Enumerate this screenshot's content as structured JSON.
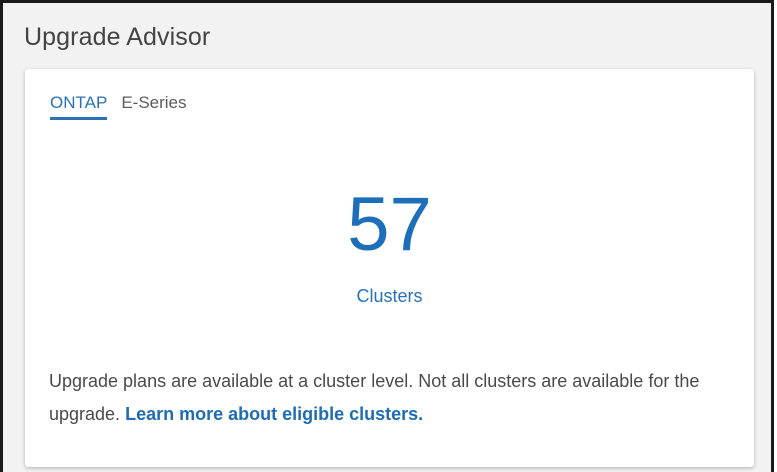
{
  "widget": {
    "title": "Upgrade Advisor"
  },
  "tabs": [
    {
      "label": "ONTAP",
      "active": true
    },
    {
      "label": "E-Series",
      "active": false
    }
  ],
  "summary": {
    "count": "57",
    "count_label": "Clusters"
  },
  "info": {
    "text": "Upgrade plans are available at a cluster level. Not all clusters are available for the upgrade.",
    "link_text": "Learn more about eligible clusters."
  },
  "colors": {
    "accent": "#1c6fb8",
    "panel_bg": "#f2f2f2",
    "card_bg": "#ffffff",
    "text": "#4a4a4a"
  }
}
